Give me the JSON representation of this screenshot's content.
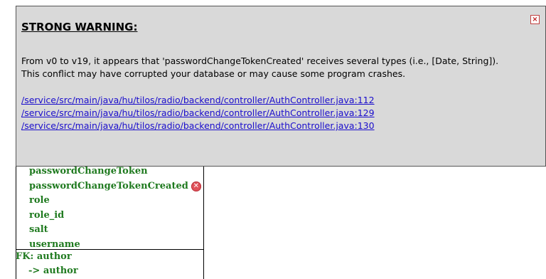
{
  "entity": {
    "fields": [
      {
        "name": "passwordChangeToken",
        "error": false
      },
      {
        "name": "passwordChangeTokenCreated",
        "error": true
      },
      {
        "name": "role",
        "error": false
      },
      {
        "name": "role_id",
        "error": false
      },
      {
        "name": "salt",
        "error": false
      },
      {
        "name": "username",
        "error": false
      }
    ],
    "fk": {
      "label": "FK: author",
      "target": "-> author"
    }
  },
  "warning": {
    "title": "STRONG WARNING:",
    "close_symbol": "×",
    "message_line1": "From v0 to v19, it appears that 'passwordChangeTokenCreated' receives several types (i.e., [Date, String]).",
    "message_line2": "This conflict may have corrupted your database or may cause some program crashes.",
    "links": [
      "/service/src/main/java/hu/tilos/radio/backend/controller/AuthController.java:112",
      "/service/src/main/java/hu/tilos/radio/backend/controller/AuthController.java:129",
      "/service/src/main/java/hu/tilos/radio/backend/controller/AuthController.java:130"
    ]
  }
}
